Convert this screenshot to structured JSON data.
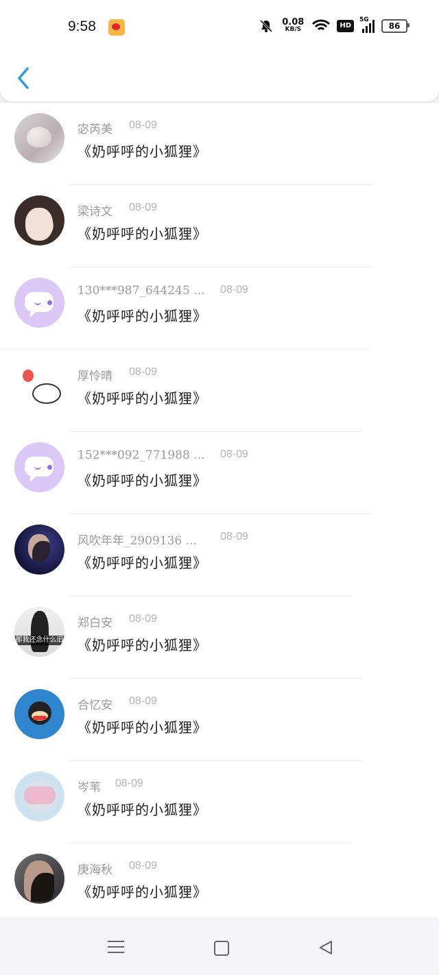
{
  "status_bar": {
    "time": "9:58",
    "net_speed_value": "0.08",
    "net_speed_unit": "KB/S",
    "hd": "HD",
    "network": "5G",
    "battery": "86"
  },
  "header": {
    "back_icon": "chevron-left-icon",
    "accent_color": "#2d9cdb"
  },
  "items": [
    {
      "name": "宓芮美",
      "date": "08-09",
      "message": "《奶呼呼的小狐狸》",
      "avatar": "heart-book"
    },
    {
      "name": "梁诗文",
      "date": "08-09",
      "message": "《奶呼呼的小狐狸》",
      "avatar": "illustrated-girl"
    },
    {
      "name": "130***987_644245 ...",
      "date": "08-09",
      "message": "《奶呼呼的小狐狸》",
      "avatar": "default-chat-bubble"
    },
    {
      "name": "厚怜晴",
      "date": "08-09",
      "message": "《奶呼呼的小狐狸》",
      "avatar": "balloon-cat"
    },
    {
      "name": "152***092_771988 ...",
      "date": "08-09",
      "message": "《奶呼呼的小狐狸》",
      "avatar": "default-chat-bubble"
    },
    {
      "name": "风吹年年_2909136 ...",
      "date": "08-09",
      "message": "《奶呼呼的小狐狸》",
      "avatar": "boy-portrait"
    },
    {
      "name": "郑白安",
      "date": "08-09",
      "message": "《奶呼呼的小狐狸》",
      "avatar": "dark-silhouette",
      "avatar_caption": "那我还念什么旧"
    },
    {
      "name": "合忆安",
      "date": "08-09",
      "message": "《奶呼呼的小狐狸》",
      "avatar": "monkey"
    },
    {
      "name": "岑苇",
      "date": "08-09",
      "message": "《奶呼呼的小狐狸》",
      "avatar": "pastel-sticker"
    },
    {
      "name": "庚海秋",
      "date": "08-09",
      "message": "《奶呼呼的小狐狸》",
      "avatar": "guy-portrait"
    }
  ],
  "nav_bar": {
    "menu_icon": "menu-icon",
    "home_icon": "home-square-icon",
    "back_icon": "back-triangle-icon"
  }
}
